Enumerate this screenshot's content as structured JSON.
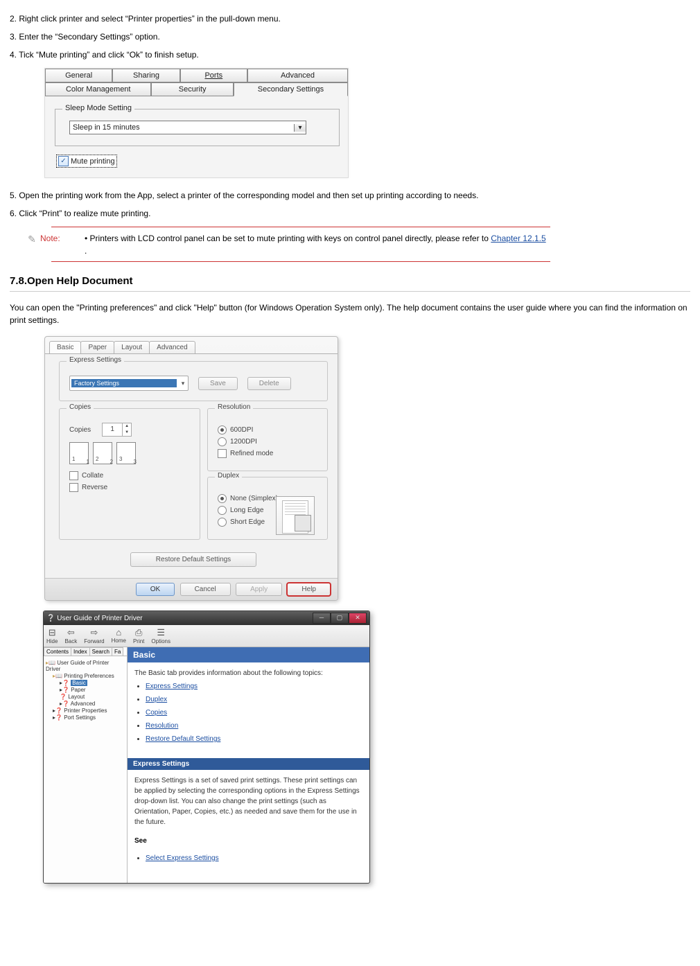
{
  "steps": {
    "s2": "2. Right click printer and select “Printer properties” in the pull-down menu.",
    "s3": "3. Enter the “Secondary Settings” option.",
    "s4": "4. Tick “Mute printing” and click “Ok” to finish setup.",
    "s5": "5. Open the printing work from the App, select a printer of the corresponding model and then set up printing according to needs.",
    "s6": "6. Click “Print” to realize mute printing."
  },
  "dialog1": {
    "tabs": [
      "General",
      "Sharing",
      "Ports",
      "Advanced",
      "Color Management",
      "Security",
      "Secondary Settings"
    ],
    "group_label": "Sleep Mode Setting",
    "combo_value": "Sleep in 15 minutes",
    "mute_label": "Mute printing"
  },
  "note": {
    "label": "Note:",
    "text_pre": "• Printers with LCD control panel can be set to mute printing with keys on control panel directly, please refer to ",
    "link": "Chapter 12.1.5",
    "text_post": " ."
  },
  "heading": "7.8.Open Help Document",
  "para": "You can open the \"Printing preferences\" and click \"Help\" button (for Windows Operation System only). The help document contains the user guide where you can find the information on print settings.",
  "dialog2": {
    "tabs": [
      "Basic",
      "Paper",
      "Layout",
      "Advanced"
    ],
    "express": {
      "group": "Express Settings",
      "value": "Factory Settings",
      "save": "Save",
      "delete": "Delete"
    },
    "copies": {
      "group": "Copies",
      "label": "Copies",
      "value": "1",
      "collate": "Collate",
      "reverse": "Reverse"
    },
    "resolution": {
      "group": "Resolution",
      "r1": "600DPI",
      "r2": "1200DPI",
      "refined": "Refined mode"
    },
    "duplex": {
      "group": "Duplex",
      "none": "None (Simplex)",
      "long": "Long Edge",
      "short": "Short Edge"
    },
    "restore": "Restore Default Settings",
    "ok": "OK",
    "cancel": "Cancel",
    "apply": "Apply",
    "help": "Help"
  },
  "helpwin": {
    "title": "User Guide of Printer Driver",
    "tools": [
      "Hide",
      "Back",
      "Forward",
      "Home",
      "Print",
      "Options"
    ],
    "nav_tabs": [
      "Contents",
      "Index",
      "Search",
      "Fa"
    ],
    "tree": {
      "root": "User Guide of Printer Driver",
      "pref": "Printing Preferences",
      "basic": "Basic",
      "paper": "Paper",
      "layout": "Layout",
      "advanced": "Advanced",
      "props": "Printer Properties",
      "ports": "Port Settings"
    },
    "banner": "Basic",
    "intro": "The Basic tab provides information about the following topics:",
    "links": [
      "Express Settings",
      "Duplex",
      "Copies",
      "Resolution",
      "Restore Default Settings"
    ],
    "subhead": "Express Settings",
    "subtext": "Express Settings is a set of saved print settings. These print settings can be applied by selecting the corresponding options in the Express Settings drop-down list. You can also change the print settings (such as Orientation, Paper, Copies, etc.) as needed and save them for the use in the future.",
    "see": "See",
    "see_item": "Select Express Settings"
  }
}
